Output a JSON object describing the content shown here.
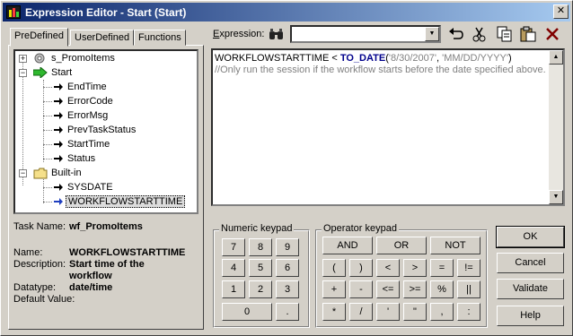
{
  "window": {
    "title": "Expression Editor - Start (Start)",
    "close_label": "✕"
  },
  "tabs": [
    {
      "label": "PreDefined",
      "active": true
    },
    {
      "label": "UserDefined",
      "active": false
    },
    {
      "label": "Functions",
      "active": false
    }
  ],
  "tree": {
    "nodes": [
      {
        "label": "s_PromoItems",
        "icon": "session-gear-icon",
        "expander": "+"
      },
      {
        "label": "Start",
        "icon": "start-arrow-icon",
        "expander": "−"
      },
      {
        "label": "EndTime",
        "icon": "variable-arrow-icon"
      },
      {
        "label": "ErrorCode",
        "icon": "variable-arrow-icon"
      },
      {
        "label": "ErrorMsg",
        "icon": "variable-arrow-icon"
      },
      {
        "label": "PrevTaskStatus",
        "icon": "variable-arrow-icon"
      },
      {
        "label": "StartTime",
        "icon": "variable-arrow-icon"
      },
      {
        "label": "Status",
        "icon": "variable-arrow-icon"
      },
      {
        "label": "Built-in",
        "icon": "folder-icon",
        "expander": "−"
      },
      {
        "label": "SYSDATE",
        "icon": "variable-arrow-icon"
      },
      {
        "label": "WORKFLOWSTARTTIME",
        "icon": "variable-arrow-icon",
        "selected": true
      }
    ]
  },
  "details": {
    "task_name_label": "Task Name:",
    "task_name_value": "wf_PromoItems",
    "name_label": "Name:",
    "name_value": "WORKFLOWSTARTTIME",
    "description_label": "Description:",
    "description_value": "Start time of the workflow",
    "datatype_label": "Datatype:",
    "datatype_value": "date/time",
    "default_label": "Default Value:"
  },
  "expression": {
    "label_pre": "E",
    "label_rest": "xpression:",
    "combo_value": "",
    "line1_a": "WORKFLOWSTARTTIME < ",
    "line1_kw": "TO_DATE",
    "line1_b": "(",
    "line1_s1": "'8/30/2007'",
    "line1_c": ", ",
    "line1_s2": "'MM/DD/YYYY'",
    "line1_d": ")",
    "line2": "//Only run the session if the workflow starts before the date specified above."
  },
  "toolbar_icons": [
    "find-binoculars-icon",
    "undo-icon",
    "cut-scissors-icon",
    "copy-icon",
    "paste-icon",
    "delete-x-icon"
  ],
  "numeric_keypad": {
    "title": "Numeric keypad",
    "keys": [
      "7",
      "8",
      "9",
      "4",
      "5",
      "6",
      "1",
      "2",
      "3",
      "0",
      "."
    ]
  },
  "operator_keypad": {
    "title": "Operator keypad",
    "row1": [
      "AND",
      "OR",
      "NOT"
    ],
    "row2": [
      "(",
      ")",
      "<",
      ">",
      "=",
      "!="
    ],
    "row3": [
      "+",
      "-",
      "<=",
      ">=",
      "%",
      "||"
    ],
    "row4": [
      "*",
      "/",
      "'",
      "\"",
      ",",
      ":"
    ]
  },
  "dialog_buttons": {
    "ok": "OK",
    "cancel": "Cancel",
    "validate": "Validate",
    "help": "Help"
  }
}
